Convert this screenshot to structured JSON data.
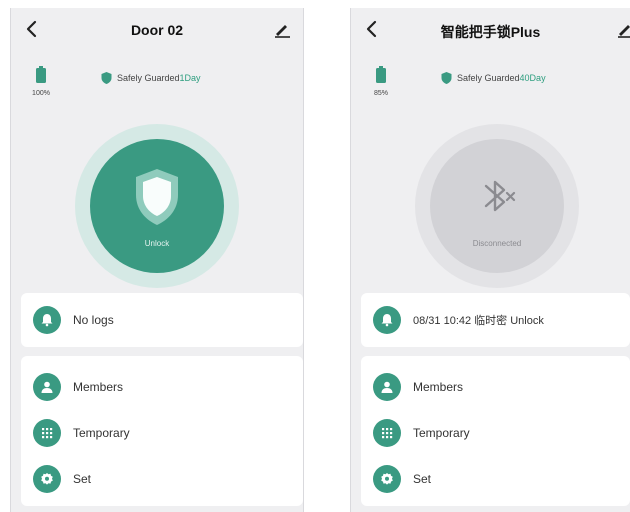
{
  "left": {
    "title": "Door 02",
    "battery": "100%",
    "guard_text": "Safely Guarded",
    "guard_days": "1Day",
    "hero_label": "Unlock",
    "log_text": "No logs",
    "menu": [
      "Members",
      "Temporary",
      "Set"
    ]
  },
  "right": {
    "title": "智能把手锁Plus",
    "battery": "85%",
    "guard_text": "Safely Guarded",
    "guard_days": "40Day",
    "hero_label": "Disconnected",
    "log_text": "08/31 10:42 临时密  Unlock",
    "menu": [
      "Members",
      "Temporary",
      "Set"
    ]
  },
  "colors": {
    "accent": "#3a9a82",
    "background": "#efeff1",
    "card": "#ffffff"
  },
  "icons": {
    "back": "chevron-left-icon",
    "edit": "pencil-icon",
    "battery": "battery-icon",
    "guard": "shield-check-icon",
    "connected": "shield-icon",
    "disconnected": "bluetooth-off-icon",
    "log": "bell-icon",
    "members": "person-icon",
    "temporary": "keypad-icon",
    "set": "gear-icon"
  }
}
